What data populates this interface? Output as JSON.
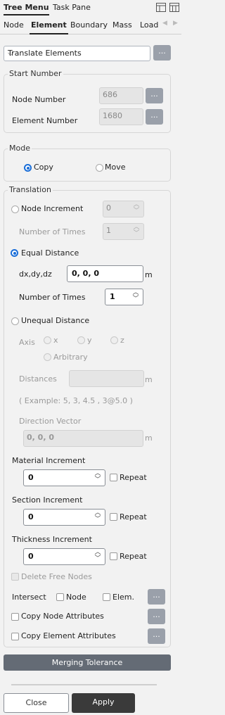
{
  "top_tabs": [
    "Tree Menu",
    "Task Pane"
  ],
  "tabs": [
    "Node",
    "Element",
    "Boundary",
    "Mass",
    "Load"
  ],
  "function_select": "Translate Elements",
  "dots": "...",
  "start_number": {
    "title": "Start Number",
    "node_label": "Node Number",
    "node_value": "686",
    "element_label": "Element Number",
    "element_value": "1680"
  },
  "mode": {
    "title": "Mode",
    "copy_label": "Copy",
    "move_label": "Move",
    "selected": "Copy"
  },
  "translation": {
    "title": "Translation",
    "node_increment_label": "Node Increment",
    "node_increment_value": "0",
    "times_label_1": "Number of Times",
    "times_value_1": "1",
    "equal_distance_label": "Equal Distance",
    "dxdydz_label": "dx,dy,dz",
    "dxdydz_value": "0, 0, 0",
    "unit_m": "m",
    "times_label_2": "Number of Times",
    "times_value_2": "1",
    "unequal_distance_label": "Unequal Distance",
    "axis_label": "Axis",
    "axis_x": "x",
    "axis_y": "y",
    "axis_z": "z",
    "axis_arbitrary": "Arbitrary",
    "distances_label": "Distances",
    "example_text": "( Example: 5, 3, 4.5 , 3@5.0 )",
    "direction_label": "Direction Vector",
    "direction_value": "0, 0, 0",
    "material_label": "Material Increment",
    "material_value": "0",
    "section_label": "Section Increment",
    "section_value": "0",
    "thickness_label": "Thickness Increment",
    "thickness_value": "0",
    "repeat_label": "Repeat"
  },
  "delete_free_nodes": "Delete Free Nodes",
  "intersect_label": "Intersect",
  "intersect_node": "Node",
  "intersect_elem": "Elem.",
  "copy_node_attr": "Copy Node Attributes",
  "copy_elem_attr": "Copy Element Attributes",
  "merging_tolerance": "Merging Tolerance",
  "close_label": "Close",
  "apply_label": "Apply"
}
